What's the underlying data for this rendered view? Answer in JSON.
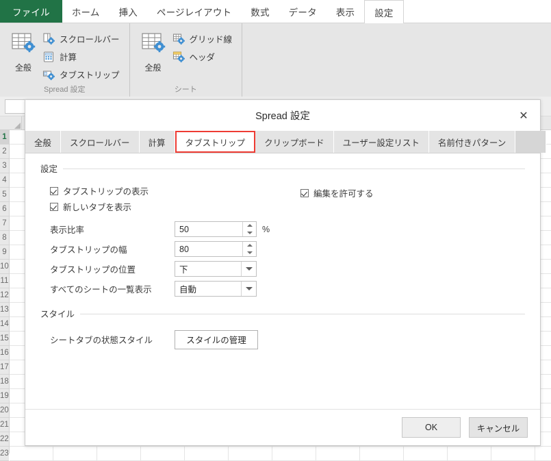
{
  "ribbon": {
    "tabs": [
      {
        "label": "ファイル",
        "kind": "file"
      },
      {
        "label": "ホーム",
        "kind": "normal"
      },
      {
        "label": "挿入",
        "kind": "normal"
      },
      {
        "label": "ページレイアウト",
        "kind": "normal"
      },
      {
        "label": "数式",
        "kind": "normal"
      },
      {
        "label": "データ",
        "kind": "normal"
      },
      {
        "label": "表示",
        "kind": "normal"
      },
      {
        "label": "設定",
        "kind": "active"
      }
    ],
    "groups": [
      {
        "title": "Spread 設定",
        "big": {
          "label": "全般",
          "icon": "grid-gear-icon"
        },
        "items": [
          {
            "label": "スクロールバー",
            "icon": "scrollbar-gear-icon"
          },
          {
            "label": "計算",
            "icon": "calculator-icon"
          },
          {
            "label": "タブストリップ",
            "icon": "tabstrip-gear-icon"
          }
        ]
      },
      {
        "title": "シート",
        "big": {
          "label": "全般",
          "icon": "grid-gear-icon"
        },
        "items": [
          {
            "label": "グリッド線",
            "icon": "gridline-gear-icon"
          },
          {
            "label": "ヘッダ",
            "icon": "header-gear-icon"
          }
        ]
      }
    ]
  },
  "sheet": {
    "row_numbers": [
      "1",
      "2",
      "3",
      "4",
      "5",
      "6",
      "7",
      "8",
      "9",
      "10",
      "11",
      "12",
      "13",
      "14",
      "15",
      "16",
      "17",
      "18",
      "19",
      "20",
      "21",
      "22",
      "23"
    ],
    "selected_row": "1"
  },
  "dialog": {
    "title": "Spread 設定",
    "close_label": "✕",
    "tabs": [
      {
        "label": "全般",
        "active": false
      },
      {
        "label": "スクロールバー",
        "active": false
      },
      {
        "label": "計算",
        "active": false
      },
      {
        "label": "タブストリップ",
        "active": true
      },
      {
        "label": "クリップボード",
        "active": false
      },
      {
        "label": "ユーザー設定リスト",
        "active": false
      },
      {
        "label": "名前付きパターン",
        "active": false
      }
    ],
    "accent_color": "#ee3b33",
    "sections": {
      "settings": {
        "title": "設定",
        "checkboxes": [
          {
            "label": "タブストリップの表示",
            "checked": true
          },
          {
            "label": "新しいタブを表示",
            "checked": true
          }
        ],
        "checkbox_right": {
          "label": "編集を許可する",
          "checked": true
        },
        "fields": [
          {
            "label": "表示比率",
            "value": "50",
            "type": "spinner",
            "suffix": "%"
          },
          {
            "label": "タブストリップの幅",
            "value": "80",
            "type": "spinner",
            "suffix": ""
          },
          {
            "label": "タブストリップの位置",
            "value": "下",
            "type": "combo",
            "suffix": ""
          },
          {
            "label": "すべてのシートの一覧表示",
            "value": "自動",
            "type": "combo",
            "suffix": ""
          }
        ]
      },
      "style": {
        "title": "スタイル",
        "row_label": "シートタブの状態スタイル",
        "button_label": "スタイルの管理"
      }
    },
    "footer": {
      "ok_label": "OK",
      "cancel_label": "キャンセル"
    }
  }
}
